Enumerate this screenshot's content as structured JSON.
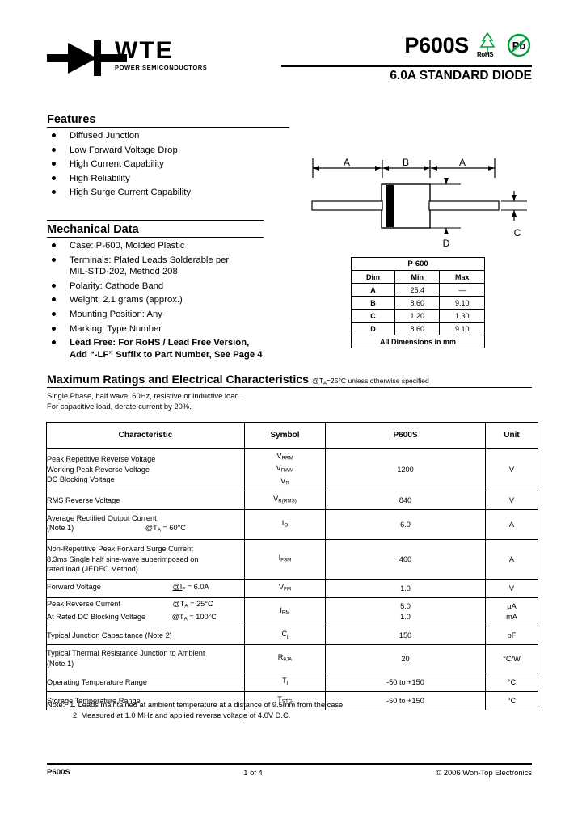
{
  "header": {
    "brand": "WTE",
    "brand_sub": "POWER SEMICONDUCTORS",
    "part_number": "P600S",
    "subtitle": "6.0A STANDARD DIODE",
    "rohs_label": "RoHS",
    "pb_label": "Pb",
    "accent_green": "#00a13a"
  },
  "features": {
    "title": "Features",
    "items": [
      "Diffused Junction",
      "Low Forward Voltage Drop",
      "High Current Capability",
      "High Reliability",
      "High Surge Current Capability"
    ]
  },
  "mechanical": {
    "title": "Mechanical Data",
    "items": [
      "Case: P-600, Molded Plastic",
      "Terminals: Plated Leads Solderable per",
      "Polarity: Cathode Band",
      "Weight: 2.1 grams (approx.)",
      "Mounting Position: Any",
      "Marking: Type Number"
    ],
    "terminals_line2": "MIL-STD-202, Method 208",
    "leadfree_line1": "Lead Free: For RoHS / Lead Free Version,",
    "leadfree_line2": "Add “-LF” Suffix to Part Number, See Page 4"
  },
  "drawing": {
    "label_a_left": "A",
    "label_b": "B",
    "label_a_right": "A",
    "label_c": "C",
    "label_d": "D"
  },
  "dim_table": {
    "title": "P-600",
    "headers": [
      "Dim",
      "Min",
      "Max"
    ],
    "rows": [
      [
        "A",
        "25.4",
        "—"
      ],
      [
        "B",
        "8.60",
        "9.10"
      ],
      [
        "C",
        "1.20",
        "1.30"
      ],
      [
        "D",
        "8.60",
        "9.10"
      ]
    ],
    "footer": "All Dimensions in mm"
  },
  "ratings": {
    "title": "Maximum Ratings and Electrical Characteristics",
    "condition": "@TA=25°C unless otherwise specified",
    "note_line1": "Single Phase, half wave, 60Hz, resistive or inductive load.",
    "note_line2": "For capacitive load, derate current by 20%.",
    "headers": [
      "Characteristic",
      "Symbol",
      "P600S",
      "Unit"
    ],
    "rows": [
      {
        "characteristic": [
          "Peak Repetitive Reverse Voltage",
          "Working Peak Reverse Voltage",
          "DC Blocking Voltage"
        ],
        "symbol_lines": [
          "VRRM",
          "VRWM",
          "VR"
        ],
        "value": "1200",
        "unit": "V"
      },
      {
        "characteristic": [
          "RMS Reverse Voltage"
        ],
        "symbol_lines": [
          "VR(RMS)"
        ],
        "value": "840",
        "unit": "V"
      },
      {
        "characteristic": [
          "Average Rectified Output Current",
          "(Note 1)"
        ],
        "condition": "@TA = 60°C",
        "symbol_lines": [
          "IO"
        ],
        "value": "6.0",
        "unit": "A"
      },
      {
        "characteristic": [
          "Non-Repetitive Peak Forward Surge Current",
          "8.3ms Single half sine-wave superimposed on",
          "rated load (JEDEC Method)"
        ],
        "symbol_lines": [
          "IFSM"
        ],
        "value": "400",
        "unit": "A"
      },
      {
        "characteristic": [
          "Forward Voltage"
        ],
        "condition": "@IF = 6.0A",
        "symbol_lines": [
          "VFM"
        ],
        "value": "1.0",
        "unit": "V"
      },
      {
        "characteristic": [
          "Peak Reverse Current",
          "At Rated DC Blocking Voltage"
        ],
        "conditions": [
          "@TA = 25°C",
          "@TA = 100°C"
        ],
        "symbol_lines": [
          "IRM"
        ],
        "values": [
          "5.0",
          "1.0"
        ],
        "units": [
          "µA",
          "mA"
        ]
      },
      {
        "characteristic": [
          "Typical Junction Capacitance (Note 2)"
        ],
        "symbol_lines": [
          "Cj"
        ],
        "value": "150",
        "unit": "pF"
      },
      {
        "characteristic": [
          "Typical Thermal Resistance Junction to Ambient",
          "(Note 1)"
        ],
        "symbol_lines": [
          "RθJA"
        ],
        "value": "20",
        "unit": "°C/W"
      },
      {
        "characteristic": [
          "Operating Temperature Range"
        ],
        "symbol_lines": [
          "Tj"
        ],
        "value": "-50 to +150",
        "unit": "°C"
      },
      {
        "characteristic": [
          "Storage Temperature Range"
        ],
        "symbol_lines": [
          "TSTG"
        ],
        "value": "-50 to +150",
        "unit": "°C"
      }
    ]
  },
  "notes": {
    "label": "Note:",
    "note1": "1. Leads maintained at ambient temperature at a distance of 9.5mm from the case",
    "note2": "2. Measured at 1.0 MHz and applied reverse voltage of 4.0V D.C."
  },
  "footer": {
    "left": "P600S",
    "center": "1 of 4",
    "right": "© 2006 Won-Top Electronics"
  }
}
